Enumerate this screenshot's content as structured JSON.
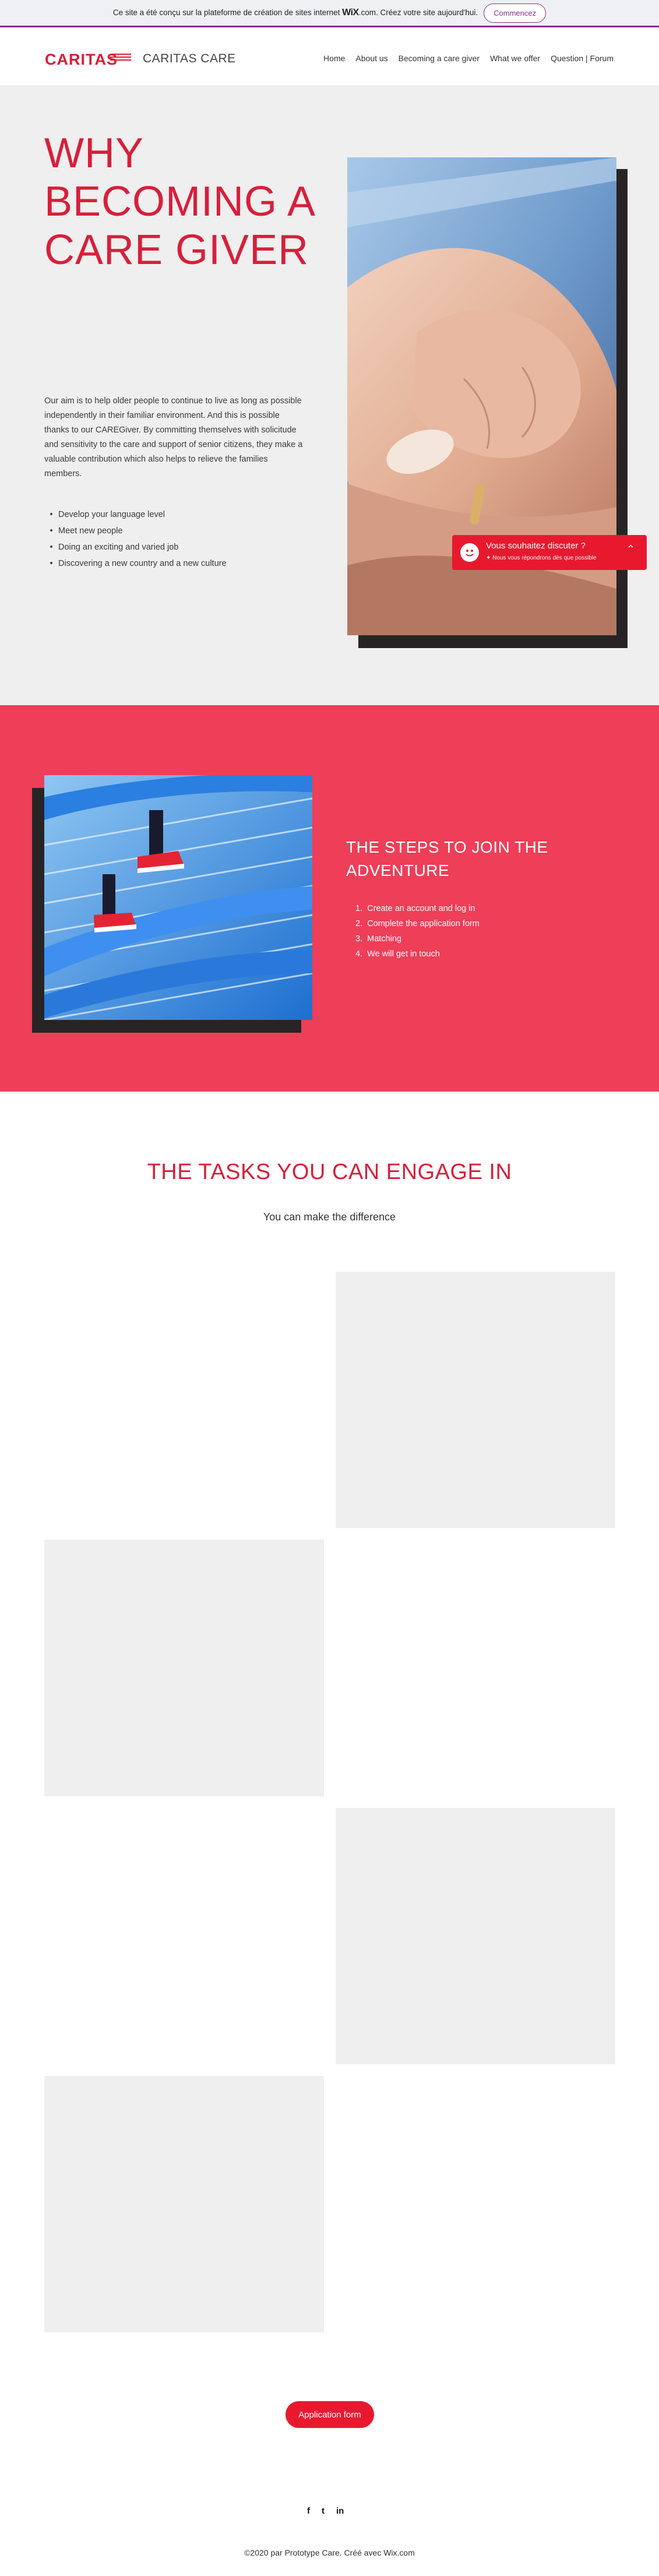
{
  "wix_banner": {
    "text_prefix": "Ce site a été conçu sur la plateforme de création de sites internet",
    "wix_logo": "WiX",
    "text_suffix": ".com. Créez votre site aujourd'hui.",
    "cta": "Commencez"
  },
  "header": {
    "logo_text": "CARITAS",
    "brand": "CARITAS CARE",
    "nav": [
      "Home",
      "About us",
      "Becoming a care giver",
      "What we offer",
      "Question | Forum"
    ]
  },
  "hero": {
    "title": "WHY BECOMING A CARE GIVER",
    "paragraph": "Our aim is to help older people to continue to live as long as possible independently in their familiar environment. And this is possible thanks to our CAREGiver. By committing themselves with solicitude and sensitivity to the care and support of senior citizens, they make a valuable contribution which also helps to relieve the families members.",
    "bullets": [
      "Develop your language level",
      "Meet new people",
      "Doing an exciting and varied job",
      "Discovering a new country and a new culture"
    ]
  },
  "chat": {
    "title": "Vous souhaitez discuter ?",
    "subtitle": "Nous vous répondrons dès que possible",
    "chevron_icon": "chevron-up-icon"
  },
  "steps": {
    "title": "THE STEPS TO JOIN THE ADVENTURE",
    "items": [
      "Create an account and log in",
      "Complete the application form",
      "Matching",
      "We will get in touch"
    ]
  },
  "tasks": {
    "title": "THE TASKS YOU CAN ENGAGE IN",
    "subtitle": "You can make the difference"
  },
  "apply_button": "Application form",
  "social": [
    "f",
    "t",
    "in"
  ],
  "footer": "©2020 par Prototype Care. Créé avec Wix.com",
  "colors": {
    "brand_red": "#d81f3a",
    "steps_bg": "#ee3e58",
    "hero_bg": "#efefef",
    "wix_purple": "#8b2c8f"
  }
}
